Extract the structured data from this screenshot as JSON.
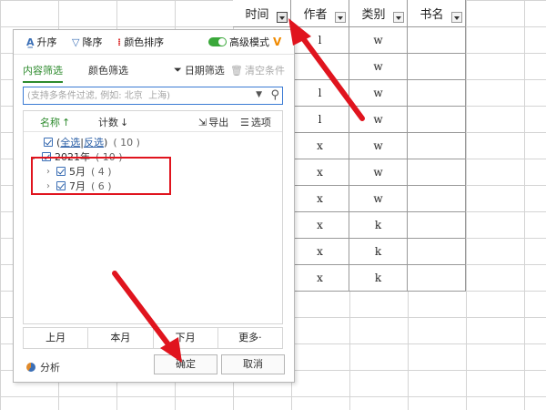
{
  "sheet": {
    "headers": [
      "时间",
      "作者",
      "类别",
      "书名"
    ],
    "rows": [
      {
        "author": "l",
        "category": "w"
      },
      {
        "author": "",
        "category": "w"
      },
      {
        "author": "l",
        "category": "w"
      },
      {
        "author": "l",
        "category": "w"
      },
      {
        "author": "x",
        "category": "w"
      },
      {
        "author": "x",
        "category": "w"
      },
      {
        "author": "x",
        "category": "w"
      },
      {
        "author": "x",
        "category": "k"
      },
      {
        "author": "x",
        "category": "k"
      },
      {
        "author": "x",
        "category": "k"
      }
    ]
  },
  "panel": {
    "toolbar": {
      "asc": "升序",
      "desc": "降序",
      "color_sort": "颜色排序",
      "advanced": "高级模式"
    },
    "tabs": {
      "content": "内容筛选",
      "color": "颜色筛选"
    },
    "date_filter": "日期筛选",
    "clear": "清空条件",
    "search_placeholder": "(支持多条件过滤, 例如: 北京  上海)",
    "list_head": {
      "name": "名称",
      "count": "计数",
      "export": "导出",
      "options": "选项"
    },
    "items": {
      "select_all": "全选",
      "invert": "反选",
      "all_count": "( 10 )",
      "year": "2021年",
      "year_count": "( 10 )",
      "may": "5月",
      "may_count": "( 4 )",
      "july": "7月",
      "july_count": "( 6 )"
    },
    "quick": [
      "上月",
      "本月",
      "下月",
      "更多·"
    ],
    "analyze": "分析",
    "ok": "确定",
    "cancel": "取消"
  },
  "colors": {
    "accent_green": "#2e8b2e",
    "annotation_red": "#e0141e"
  }
}
